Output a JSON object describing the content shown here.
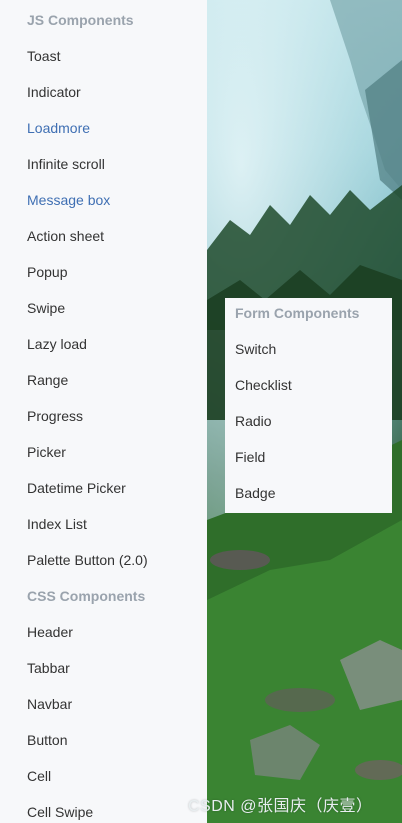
{
  "sidebar": {
    "js_section_title": "JS Components",
    "js_items": [
      {
        "label": "Toast"
      },
      {
        "label": "Indicator"
      },
      {
        "label": "Loadmore"
      },
      {
        "label": "Infinite scroll"
      },
      {
        "label": "Message box"
      },
      {
        "label": "Action sheet"
      },
      {
        "label": "Popup"
      },
      {
        "label": "Swipe"
      },
      {
        "label": "Lazy load"
      },
      {
        "label": "Range"
      },
      {
        "label": "Progress"
      },
      {
        "label": "Picker"
      },
      {
        "label": "Datetime Picker"
      },
      {
        "label": "Index List"
      },
      {
        "label": "Palette Button (2.0)"
      }
    ],
    "css_section_title": "CSS Components",
    "css_items": [
      {
        "label": "Header"
      },
      {
        "label": "Tabbar"
      },
      {
        "label": "Navbar"
      },
      {
        "label": "Button"
      },
      {
        "label": "Cell"
      },
      {
        "label": "Cell Swipe"
      }
    ]
  },
  "form_panel": {
    "section_title": "Form Components",
    "items": [
      {
        "label": "Switch"
      },
      {
        "label": "Checklist"
      },
      {
        "label": "Radio"
      },
      {
        "label": "Field"
      },
      {
        "label": "Badge"
      }
    ]
  },
  "watermark": "CSDN @张国庆（庆壹）",
  "colors": {
    "link": "#3f6fb3",
    "text": "#333333",
    "section_title": "#9aa3ad",
    "panel_bg": "#f7f8fa"
  }
}
